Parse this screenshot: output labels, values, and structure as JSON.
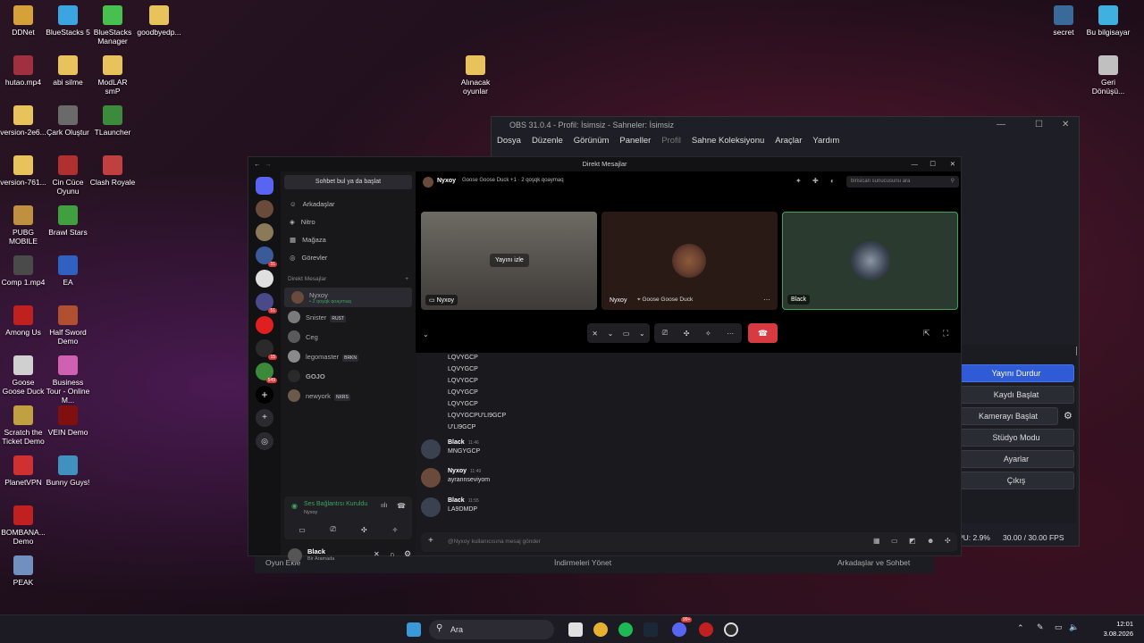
{
  "desktop_icons_left": [
    {
      "label": "DDNet",
      "color": "#d7a13a"
    },
    {
      "label": "BlueStacks 5",
      "color": "#3aa5e0"
    },
    {
      "label": "BlueStacks Manager",
      "color": "#48c050"
    },
    {
      "label": "goodbyedp...",
      "color": "#e8c25a"
    },
    {
      "label": "hutao.mp4",
      "color": "#a03040"
    },
    {
      "label": "abi silme",
      "color": "#e8c25a"
    },
    {
      "label": "ModLAR smP",
      "color": "#e8c25a"
    },
    {
      "label": "version-2e6...",
      "color": "#e8c25a"
    },
    {
      "label": "Çark Oluştur",
      "color": "#6a6a6a"
    },
    {
      "label": "TLauncher",
      "color": "#3c8a3c"
    },
    {
      "label": "version-761...",
      "color": "#e8c25a"
    },
    {
      "label": "Cin Cüce Oyunu",
      "color": "#b03030"
    },
    {
      "label": "Clash Royale",
      "color": "#c04040"
    },
    {
      "label": "PUBG MOBILE",
      "color": "#c09040"
    },
    {
      "label": "Brawl Stars",
      "color": "#40a040"
    },
    {
      "label": "Comp 1.mp4",
      "color": "#4a4a4a"
    },
    {
      "label": "EA",
      "color": "#3060c0"
    },
    {
      "label": "Among Us",
      "color": "#c02020"
    },
    {
      "label": "Half Sword Demo",
      "color": "#b05030"
    },
    {
      "label": "Goose Goose Duck",
      "color": "#d0d0d0"
    },
    {
      "label": "Business Tour - Online M...",
      "color": "#d060b0"
    },
    {
      "label": "Scratch the Ticket Demo",
      "color": "#c0a040"
    },
    {
      "label": "VEIN Demo",
      "color": "#801010"
    },
    {
      "label": "PlanetVPN",
      "color": "#d03030"
    },
    {
      "label": "Bunny Guys!",
      "color": "#4090c0"
    },
    {
      "label": "BOMBANA... Demo",
      "color": "#c02020"
    },
    {
      "label": "PEAK",
      "color": "#7090c0"
    }
  ],
  "desktop_icons_mid": [
    {
      "label": "Alınacak oyunlar",
      "color": "#e8c25a"
    }
  ],
  "desktop_icons_right": [
    {
      "label": "secret",
      "color": "#3a6a9a"
    },
    {
      "label": "Bu bilgisayar",
      "color": "#40b0e0"
    },
    {
      "label": "Geri Dönüşü...",
      "color": "#c0c0c0"
    }
  ],
  "obs": {
    "title": "OBS 31.0.4 - Profil: İsimsiz - Sahneler: İsimsiz",
    "menu": [
      "Dosya",
      "Düzenle",
      "Görünüm",
      "Paneller",
      "Profil",
      "Sahne Koleksiyonu",
      "Araçlar",
      "Yardım"
    ],
    "buttons": [
      "Yayını Durdur",
      "Kaydı Başlat",
      "Kamerayı Başlat",
      "Stüdyo Modu",
      "Ayarlar",
      "Çıkış"
    ],
    "status_cpu": "PU: 2.9%",
    "status_fps": "30.00 / 30.00 FPS"
  },
  "discord": {
    "window_title": "Direkt Mesajlar",
    "search_button": "Sohbet bul ya da başlat",
    "nav": [
      {
        "label": "Arkadaşlar",
        "icon": "friends-icon"
      },
      {
        "label": "Nitro",
        "icon": "nitro-icon"
      },
      {
        "label": "Mağaza",
        "icon": "shop-icon"
      },
      {
        "label": "Görevler",
        "icon": "quests-icon"
      }
    ],
    "dm_header": "Direkt Mesajlar",
    "dms": [
      {
        "name": "Nyxoy",
        "sub": "• 2 qoşqk qoaymaq",
        "tag": "",
        "color": "#6a4a3a"
      },
      {
        "name": "Snister",
        "sub": "",
        "tag": "RUST",
        "color": "#7a7a7a"
      },
      {
        "name": "Ceg",
        "sub": "",
        "tag": "",
        "color": "#5a5a5a"
      },
      {
        "name": "legomaster",
        "sub": "",
        "tag": "BRKN",
        "color": "#8a8a8a"
      },
      {
        "name": "GOJO",
        "sub": "",
        "tag": "",
        "color": "#2a2a2a"
      },
      {
        "name": "newyork",
        "sub": "",
        "tag": "NXRS",
        "color": "#6a5a4a"
      }
    ],
    "rail_badges": [
      "31",
      "51",
      "15",
      "549"
    ],
    "voice_status": "Ses Bağlantısı Kuruldu",
    "voice_channel": "Nyxoy",
    "user_name": "Black",
    "user_status": "Bir Aramada",
    "call_header_name": "Nyxoy",
    "call_header_activity": "Goose Goose Duck +1 · 2 qoşqk qoaymaq",
    "search_placeholder": "birisican sunucusunu ara",
    "tiles": [
      {
        "label": "Nyxoy",
        "overlay": "Yayını izle"
      },
      {
        "label": "Nyxoy",
        "activity": "Goose Goose Duck"
      },
      {
        "label": "Black"
      }
    ],
    "chat_lines": [
      "LQVYGCP",
      "LQVYGCP",
      "LQVYGCP",
      "LQVYGCP",
      "LQVYGCP",
      "LQVYGCPU'LI9GCP",
      "U'LI9GCP"
    ],
    "messages": [
      {
        "author": "Black",
        "time": "11:46",
        "text": "MNGYGCP"
      },
      {
        "author": "Nyxoy",
        "time": "11:49",
        "text": "ayrannseviyom"
      },
      {
        "author": "Black",
        "time": "11:55",
        "text": "LA9DMDP"
      }
    ],
    "composer_placeholder": "@Nyxoy kullanıcısına mesaj gönder"
  },
  "launcher_strip": {
    "add_game": "Oyun Ekle",
    "downloads": "İndirmeleri Yönet",
    "friends": "Arkadaşlar ve Sohbet"
  },
  "taskbar": {
    "search": "Ara",
    "time": "12:01",
    "date": "3.08.2026",
    "discord_badge": "99+"
  }
}
